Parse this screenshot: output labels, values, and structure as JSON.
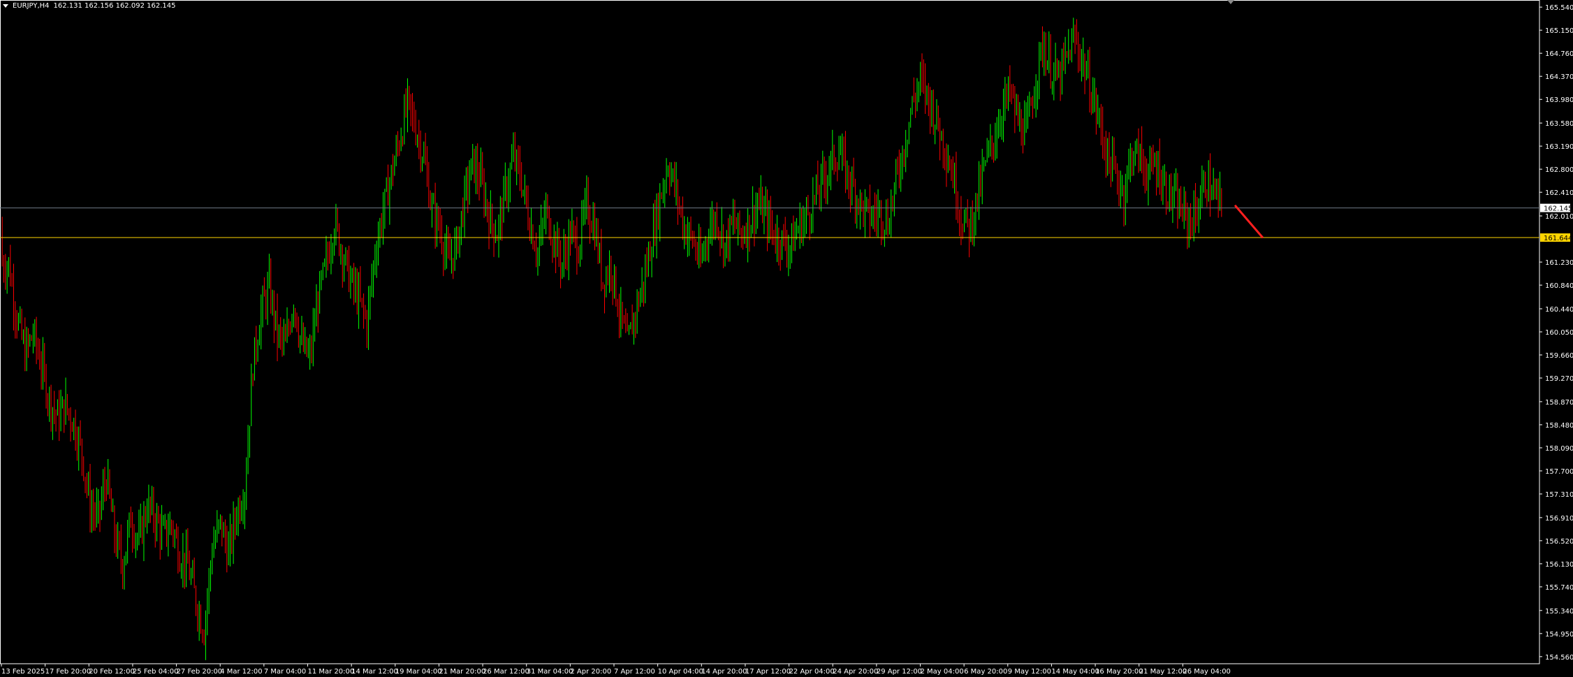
{
  "window": {
    "background": "#000000",
    "axis_color": "#ffffff",
    "grid": false
  },
  "header": {
    "symbol_label": "EURJPY,H4",
    "ohlc_text": "162.131 162.156 162.092 162.145",
    "menu_icon": "triangle-down-icon"
  },
  "colors": {
    "bull": "#00ff00",
    "bear": "#ff0000",
    "level_line": "#ffd400",
    "current_line": "#6e7a87",
    "arrow": "#ff1f1f"
  },
  "price_axis": {
    "ticks": [
      "165.540",
      "165.150",
      "164.760",
      "164.370",
      "163.980",
      "163.580",
      "163.190",
      "162.800",
      "162.410",
      "162.010",
      "161.230",
      "160.840",
      "160.440",
      "160.050",
      "159.660",
      "159.270",
      "158.870",
      "158.480",
      "158.090",
      "157.700",
      "157.310",
      "156.910",
      "156.520",
      "156.130",
      "155.740",
      "155.340",
      "154.950",
      "154.560"
    ],
    "current_price_label": "162.145",
    "level_price_label": "161.644"
  },
  "time_axis": {
    "ticks": [
      "13 Feb 2025",
      "17 Feb 20:00",
      "20 Feb 12:00",
      "25 Feb 04:00",
      "27 Feb 20:00",
      "4 Mar 12:00",
      "7 Mar 04:00",
      "11 Mar 20:00",
      "14 Mar 12:00",
      "19 Mar 04:00",
      "21 Mar 20:00",
      "26 Mar 12:00",
      "31 Mar 04:00",
      "2 Apr 20:00",
      "7 Apr 12:00",
      "10 Apr 04:00",
      "14 Apr 20:00",
      "17 Apr 12:00",
      "22 Apr 04:00",
      "24 Apr 20:00",
      "29 Apr 12:00",
      "2 May 04:00",
      "6 May 20:00",
      "9 May 12:00",
      "14 May 04:00",
      "16 May 20:00",
      "21 May 12:00",
      "26 May 04:00"
    ]
  },
  "chart_data": {
    "type": "candlestick",
    "symbol": "EURJPY",
    "timeframe": "H4",
    "ylim": [
      154.44,
      165.66
    ],
    "current_price": 162.145,
    "horizontal_level": 161.644,
    "projection": {
      "from_price": 162.19,
      "to_price": 161.64,
      "direction": "down"
    },
    "closes_approx": [
      161.2,
      160.3,
      159.7,
      160.0,
      159.5,
      158.9,
      158.6,
      158.8,
      158.5,
      158.0,
      157.1,
      156.9,
      157.6,
      156.6,
      156.1,
      156.9,
      156.5,
      157.1,
      156.9,
      156.6,
      156.8,
      156.3,
      156.1,
      155.5,
      155.0,
      156.4,
      156.8,
      156.3,
      157.0,
      157.4,
      159.5,
      160.4,
      160.8,
      160.0,
      159.8,
      160.6,
      159.8,
      159.6,
      160.6,
      161.2,
      161.9,
      161.4,
      160.9,
      160.6,
      160.2,
      161.4,
      162.1,
      162.7,
      163.3,
      163.9,
      163.5,
      163.0,
      162.1,
      161.8,
      161.2,
      161.5,
      162.3,
      162.9,
      162.6,
      162.0,
      161.7,
      162.4,
      163.0,
      162.6,
      161.9,
      161.4,
      162.1,
      161.6,
      161.2,
      161.7,
      161.5,
      162.2,
      161.8,
      160.9,
      161.2,
      160.4,
      159.8,
      160.4,
      160.9,
      161.6,
      162.3,
      162.9,
      162.4,
      161.8,
      161.6,
      161.2,
      161.8,
      162.0,
      161.5,
      161.9,
      161.7,
      161.9,
      162.2,
      162.0,
      161.7,
      161.6,
      161.5,
      161.8,
      162.0,
      162.3,
      162.6,
      162.9,
      163.1,
      162.7,
      162.4,
      162.1,
      162.0,
      162.1,
      161.9,
      162.6,
      163.2,
      163.9,
      164.3,
      164.0,
      163.6,
      163.2,
      162.7,
      162.0,
      161.8,
      162.3,
      162.9,
      163.3,
      163.8,
      164.1,
      163.6,
      163.4,
      164.2,
      164.9,
      164.5,
      164.3,
      164.7,
      165.0,
      164.6,
      164.1,
      163.6,
      163.0,
      162.7,
      162.4,
      163.1,
      163.0,
      162.7,
      162.9,
      162.5,
      162.3,
      162.1,
      161.9,
      162.1,
      162.6,
      162.4,
      162.145
    ]
  }
}
